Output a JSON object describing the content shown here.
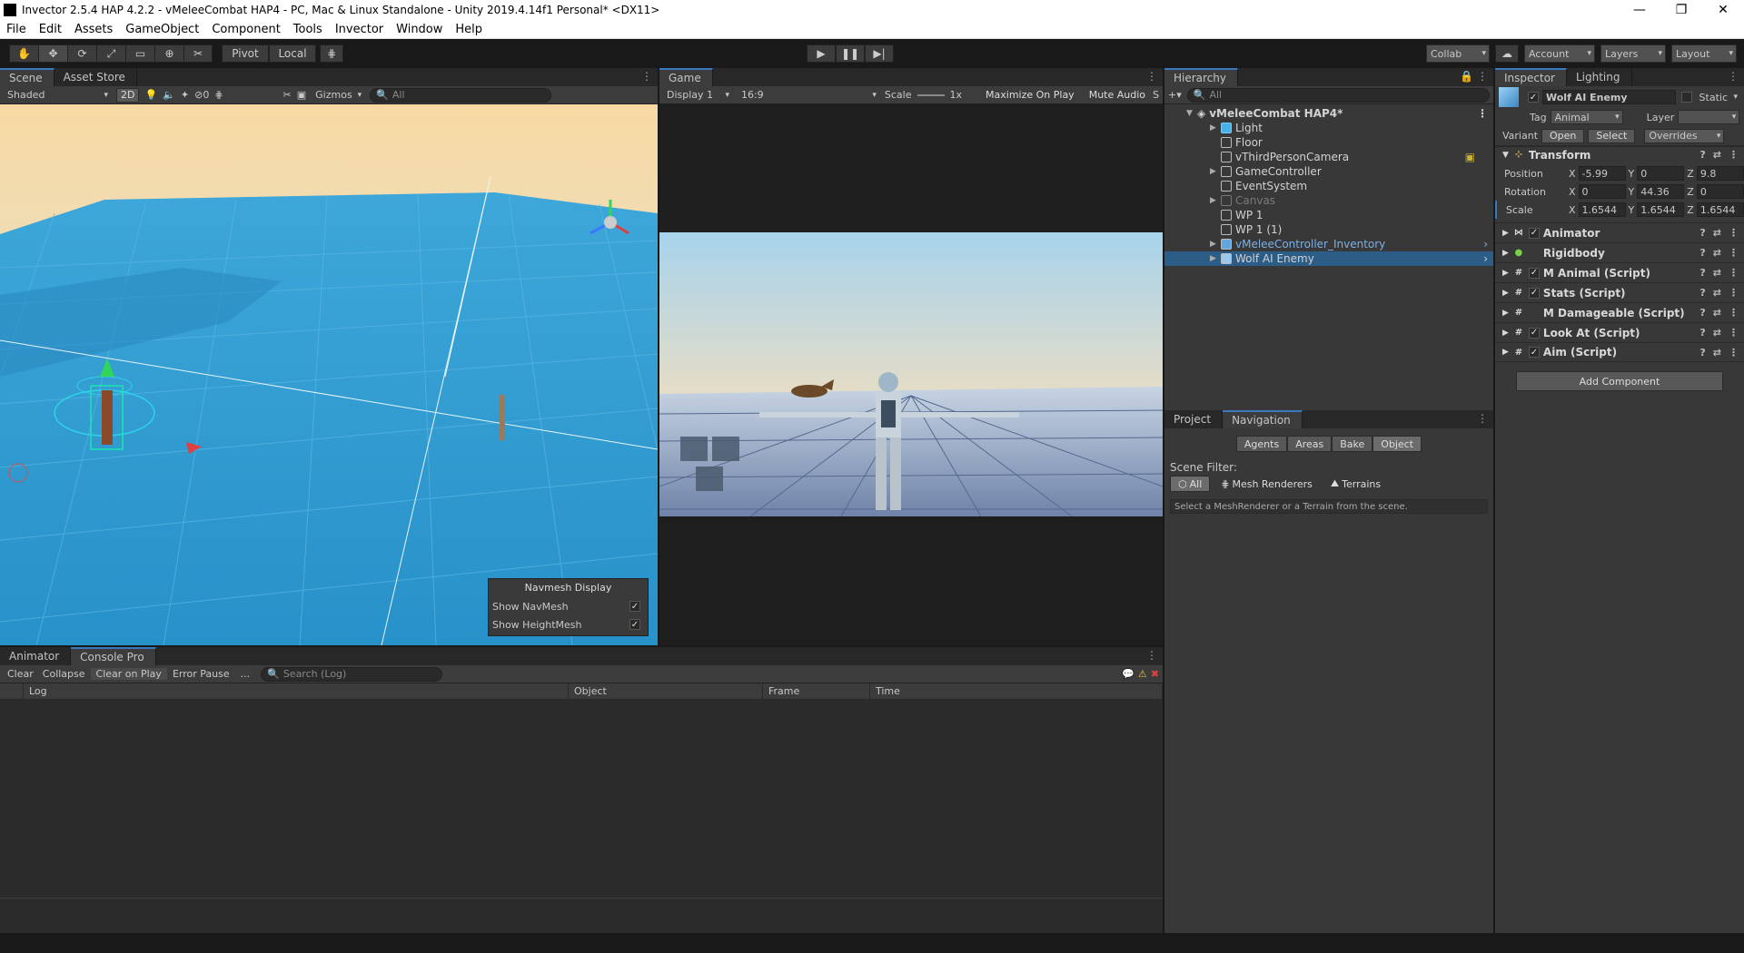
{
  "window": {
    "title": "Invector 2.5.4 HAP 4.2.2 - vMeleeCombat HAP4 - PC, Mac & Linux Standalone - Unity 2019.4.14f1 Personal* <DX11>"
  },
  "menu": [
    "File",
    "Edit",
    "Assets",
    "GameObject",
    "Component",
    "Tools",
    "Invector",
    "Window",
    "Help"
  ],
  "toolbar": {
    "pivot": "Pivot",
    "local": "Local",
    "collab": "Collab",
    "account": "Account",
    "layers": "Layers",
    "layout": "Layout"
  },
  "scene": {
    "tab_scene": "Scene",
    "tab_asset_store": "Asset Store",
    "shading": "Shaded",
    "mode_2d": "2D",
    "fx_count": "0",
    "gizmos": "Gizmos",
    "search_placeholder": "All",
    "navmesh": {
      "title": "Navmesh Display",
      "show_navmesh": "Show NavMesh",
      "show_heightmesh": "Show HeightMesh"
    }
  },
  "game": {
    "tab": "Game",
    "display": "Display 1",
    "aspect": "16:9",
    "scale_label": "Scale",
    "scale_value": "1x",
    "maximize": "Maximize On Play",
    "mute": "Mute Audio",
    "stats": "S"
  },
  "hierarchy": {
    "tab": "Hierarchy",
    "search_placeholder": "All",
    "scene_name": "vMeleeCombat HAP4*",
    "items": [
      "Light",
      "Floor",
      "vThirdPersonCamera",
      "GameController",
      "EventSystem",
      "Canvas",
      "WP 1",
      "WP 1 (1)",
      "vMeleeController_Inventory",
      "Wolf AI Enemy"
    ]
  },
  "inspector": {
    "tab": "Inspector",
    "tab_lighting": "Lighting",
    "object_name": "Wolf AI Enemy",
    "static": "Static",
    "tag_label": "Tag",
    "tag": "Animal",
    "layer_label": "Layer",
    "layer": "",
    "variant_label": "Variant",
    "open": "Open",
    "select": "Select",
    "overrides": "Overrides",
    "transform": {
      "title": "Transform",
      "position_label": "Position",
      "rotation_label": "Rotation",
      "scale_label": "Scale",
      "position": {
        "x": "-5.99",
        "y": "0",
        "z": "9.8"
      },
      "rotation": {
        "x": "0",
        "y": "44.36",
        "z": "0"
      },
      "scale": {
        "x": "1.6544",
        "y": "1.6544",
        "z": "1.6544"
      }
    },
    "components": [
      "Animator",
      "Rigidbody",
      "M Animal (Script)",
      "Stats (Script)",
      "M Damageable (Script)",
      "Look At (Script)",
      "Aim (Script)"
    ],
    "add_component": "Add Component"
  },
  "navigation": {
    "tab_project": "Project",
    "tab_navigation": "Navigation",
    "tabs": [
      "Agents",
      "Areas",
      "Bake",
      "Object"
    ],
    "scene_filter_label": "Scene Filter:",
    "filters": [
      "All",
      "Mesh Renderers",
      "Terrains"
    ],
    "hint": "Select a MeshRenderer or a Terrain from the scene."
  },
  "console": {
    "tab_animator": "Animator",
    "tab_console": "Console Pro",
    "buttons": [
      "Clear",
      "Collapse",
      "Clear on Play",
      "Error Pause",
      "..."
    ],
    "search_placeholder": "Search (Log)",
    "columns": [
      "Log",
      "Object",
      "Frame",
      "Time"
    ]
  }
}
